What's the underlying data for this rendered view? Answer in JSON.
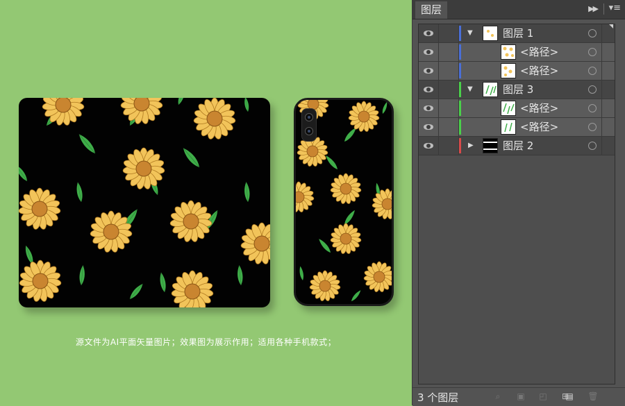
{
  "caption": "源文件为AI平面矢量图片；效果图为展示作用；适用各种手机款式；",
  "panel": {
    "tab_label": "图层",
    "collapse_icon": "double-chevron-right-icon",
    "menu_icon": "panel-menu-icon",
    "footer_count": "3 个图层",
    "footer_icons": [
      "search-icon",
      "export-icon",
      "clipping-mask-icon",
      "new-sublayer-icon",
      "new-layer-icon",
      "delete-icon"
    ]
  },
  "layers": [
    {
      "name": "图层  1",
      "type": "parent",
      "expanded": true,
      "color": "#4a6fd8"
    },
    {
      "name": "<路径>",
      "type": "child",
      "color": "#4a6fd8"
    },
    {
      "name": "<路径>",
      "type": "child",
      "color": "#4a6fd8"
    },
    {
      "name": "图层  3",
      "type": "parent",
      "expanded": true,
      "color": "#4ad04a"
    },
    {
      "name": "<路径>",
      "type": "child",
      "color": "#4ad04a"
    },
    {
      "name": "<路径>",
      "type": "child",
      "color": "#4ad04a"
    },
    {
      "name": "图层  2",
      "type": "collapsed",
      "expanded": false,
      "color": "#d84a4a"
    }
  ],
  "colors": {
    "canvas_bg": "#93c873",
    "petal": "#f2c45a",
    "center": "#c98530",
    "leaf": "#3fae49",
    "mock_bg": "#020202"
  }
}
